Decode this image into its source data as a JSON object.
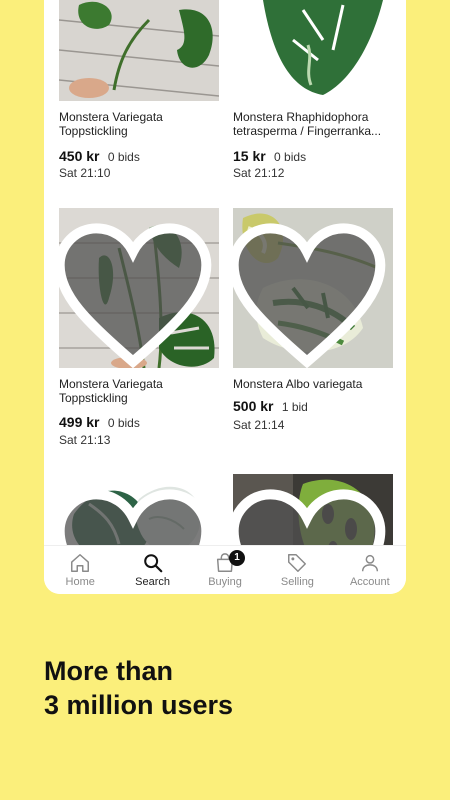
{
  "listings": [
    {
      "title": "Monstera Variegata Toppstickling",
      "price": "450 kr",
      "bids": "0 bids",
      "time": "Sat 21:10"
    },
    {
      "title": "Monstera Rhaphidophora tetrasperma / Fingerranka...",
      "price": "15 kr",
      "bids": "0 bids",
      "time": "Sat 21:12"
    },
    {
      "title": "Monstera Variegata Toppstickling",
      "price": "499 kr",
      "bids": "0 bids",
      "time": "Sat 21:13"
    },
    {
      "title": "Monstera Albo variegata",
      "price": "500 kr",
      "bids": "1 bid",
      "time": "Sat 21:14"
    }
  ],
  "tabs": [
    {
      "label": "Home",
      "icon": "home-icon"
    },
    {
      "label": "Search",
      "icon": "search-icon"
    },
    {
      "label": "Buying",
      "icon": "shopping-bag-icon",
      "badge": "1"
    },
    {
      "label": "Selling",
      "icon": "tag-icon"
    },
    {
      "label": "Account",
      "icon": "person-icon"
    }
  ],
  "headline": {
    "line1": "More than",
    "line2": "3 million users"
  },
  "colors": {
    "background": "#fbef7b",
    "card": "#ffffff",
    "leaf": "#2f6b2a"
  }
}
